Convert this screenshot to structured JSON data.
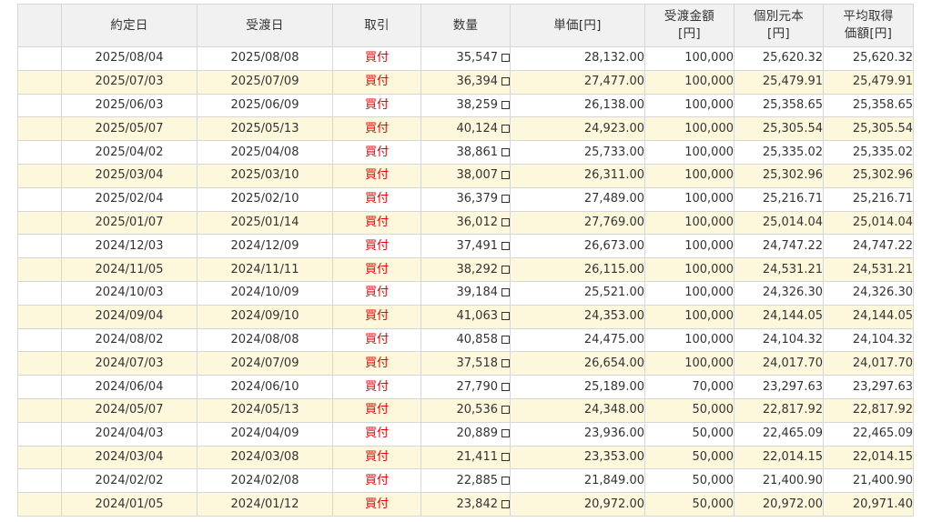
{
  "headers": {
    "blank": "",
    "contract_date": "約定日",
    "delivery_date": "受渡日",
    "trade_type": "取引",
    "quantity": "数量",
    "unit_price": "単価[円]",
    "delivery_amount_line1": "受渡金額",
    "delivery_amount_line2": "[円]",
    "individual_principal_line1": "個別元本",
    "individual_principal_line2": "[円]",
    "average_cost_line1": "平均取得",
    "average_cost_line2": "価額[円]"
  },
  "rows": [
    {
      "contract_date": "2025/08/04",
      "delivery_date": "2025/08/08",
      "trade_type": "買付",
      "quantity": "35,547",
      "unit_price": "28,132.00",
      "delivery_amount": "100,000",
      "individual_principal": "25,620.32",
      "average_cost": "25,620.32"
    },
    {
      "contract_date": "2025/07/03",
      "delivery_date": "2025/07/09",
      "trade_type": "買付",
      "quantity": "36,394",
      "unit_price": "27,477.00",
      "delivery_amount": "100,000",
      "individual_principal": "25,479.91",
      "average_cost": "25,479.91"
    },
    {
      "contract_date": "2025/06/03",
      "delivery_date": "2025/06/09",
      "trade_type": "買付",
      "quantity": "38,259",
      "unit_price": "26,138.00",
      "delivery_amount": "100,000",
      "individual_principal": "25,358.65",
      "average_cost": "25,358.65"
    },
    {
      "contract_date": "2025/05/07",
      "delivery_date": "2025/05/13",
      "trade_type": "買付",
      "quantity": "40,124",
      "unit_price": "24,923.00",
      "delivery_amount": "100,000",
      "individual_principal": "25,305.54",
      "average_cost": "25,305.54"
    },
    {
      "contract_date": "2025/04/02",
      "delivery_date": "2025/04/08",
      "trade_type": "買付",
      "quantity": "38,861",
      "unit_price": "25,733.00",
      "delivery_amount": "100,000",
      "individual_principal": "25,335.02",
      "average_cost": "25,335.02"
    },
    {
      "contract_date": "2025/03/04",
      "delivery_date": "2025/03/10",
      "trade_type": "買付",
      "quantity": "38,007",
      "unit_price": "26,311.00",
      "delivery_amount": "100,000",
      "individual_principal": "25,302.96",
      "average_cost": "25,302.96"
    },
    {
      "contract_date": "2025/02/04",
      "delivery_date": "2025/02/10",
      "trade_type": "買付",
      "quantity": "36,379",
      "unit_price": "27,489.00",
      "delivery_amount": "100,000",
      "individual_principal": "25,216.71",
      "average_cost": "25,216.71"
    },
    {
      "contract_date": "2025/01/07",
      "delivery_date": "2025/01/14",
      "trade_type": "買付",
      "quantity": "36,012",
      "unit_price": "27,769.00",
      "delivery_amount": "100,000",
      "individual_principal": "25,014.04",
      "average_cost": "25,014.04"
    },
    {
      "contract_date": "2024/12/03",
      "delivery_date": "2024/12/09",
      "trade_type": "買付",
      "quantity": "37,491",
      "unit_price": "26,673.00",
      "delivery_amount": "100,000",
      "individual_principal": "24,747.22",
      "average_cost": "24,747.22"
    },
    {
      "contract_date": "2024/11/05",
      "delivery_date": "2024/11/11",
      "trade_type": "買付",
      "quantity": "38,292",
      "unit_price": "26,115.00",
      "delivery_amount": "100,000",
      "individual_principal": "24,531.21",
      "average_cost": "24,531.21"
    },
    {
      "contract_date": "2024/10/03",
      "delivery_date": "2024/10/09",
      "trade_type": "買付",
      "quantity": "39,184",
      "unit_price": "25,521.00",
      "delivery_amount": "100,000",
      "individual_principal": "24,326.30",
      "average_cost": "24,326.30"
    },
    {
      "contract_date": "2024/09/04",
      "delivery_date": "2024/09/10",
      "trade_type": "買付",
      "quantity": "41,063",
      "unit_price": "24,353.00",
      "delivery_amount": "100,000",
      "individual_principal": "24,144.05",
      "average_cost": "24,144.05"
    },
    {
      "contract_date": "2024/08/02",
      "delivery_date": "2024/08/08",
      "trade_type": "買付",
      "quantity": "40,858",
      "unit_price": "24,475.00",
      "delivery_amount": "100,000",
      "individual_principal": "24,104.32",
      "average_cost": "24,104.32"
    },
    {
      "contract_date": "2024/07/03",
      "delivery_date": "2024/07/09",
      "trade_type": "買付",
      "quantity": "37,518",
      "unit_price": "26,654.00",
      "delivery_amount": "100,000",
      "individual_principal": "24,017.70",
      "average_cost": "24,017.70"
    },
    {
      "contract_date": "2024/06/04",
      "delivery_date": "2024/06/10",
      "trade_type": "買付",
      "quantity": "27,790",
      "unit_price": "25,189.00",
      "delivery_amount": "70,000",
      "individual_principal": "23,297.63",
      "average_cost": "23,297.63"
    },
    {
      "contract_date": "2024/05/07",
      "delivery_date": "2024/05/13",
      "trade_type": "買付",
      "quantity": "20,536",
      "unit_price": "24,348.00",
      "delivery_amount": "50,000",
      "individual_principal": "22,817.92",
      "average_cost": "22,817.92"
    },
    {
      "contract_date": "2024/04/03",
      "delivery_date": "2024/04/09",
      "trade_type": "買付",
      "quantity": "20,889",
      "unit_price": "23,936.00",
      "delivery_amount": "50,000",
      "individual_principal": "22,465.09",
      "average_cost": "22,465.09"
    },
    {
      "contract_date": "2024/03/04",
      "delivery_date": "2024/03/08",
      "trade_type": "買付",
      "quantity": "21,411",
      "unit_price": "23,353.00",
      "delivery_amount": "50,000",
      "individual_principal": "22,014.15",
      "average_cost": "22,014.15"
    },
    {
      "contract_date": "2024/02/02",
      "delivery_date": "2024/02/08",
      "trade_type": "買付",
      "quantity": "22,885",
      "unit_price": "21,849.00",
      "delivery_amount": "50,000",
      "individual_principal": "21,400.90",
      "average_cost": "21,400.90"
    },
    {
      "contract_date": "2024/01/05",
      "delivery_date": "2024/01/12",
      "trade_type": "買付",
      "quantity": "23,842",
      "unit_price": "20,972.00",
      "delivery_amount": "50,000",
      "individual_principal": "20,972.00",
      "average_cost": "20,971.40"
    }
  ],
  "colors": {
    "header_bg": "#f1f1f1",
    "row_stripe": "#fdf7dc",
    "buy_text": "#e60000",
    "border": "#d6d6d6"
  },
  "icons": {
    "quantity_marker": "checkbox-square-icon"
  }
}
